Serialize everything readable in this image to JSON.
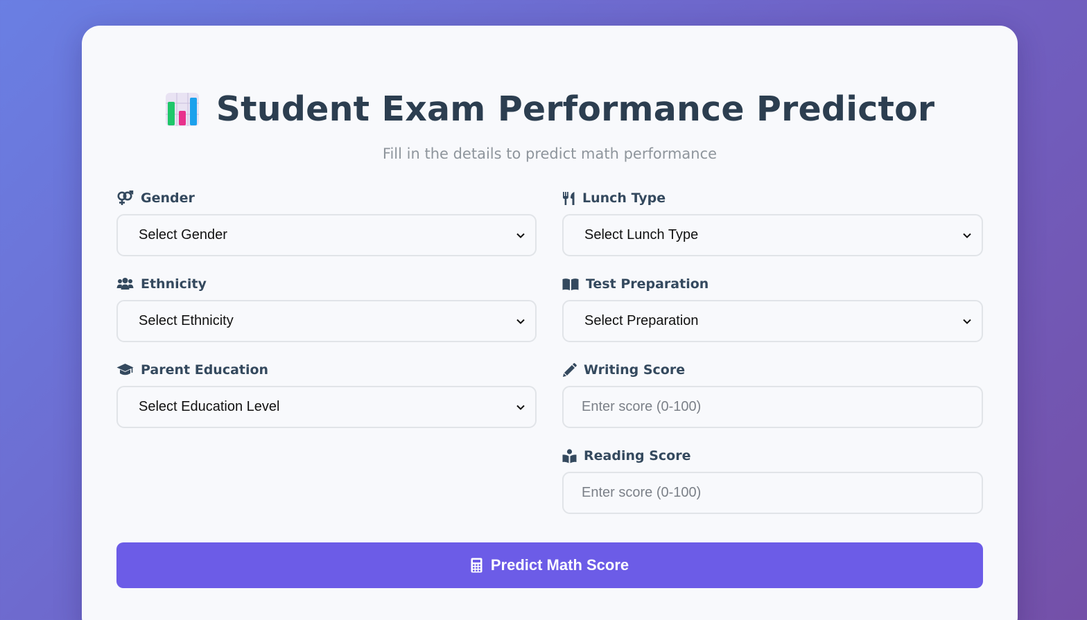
{
  "header": {
    "title": "Student Exam Performance Predictor",
    "subtitle": "Fill in the details to predict math performance",
    "icon": "bar-chart-icon"
  },
  "form": {
    "gender": {
      "label": "Gender",
      "icon": "venus-mars-icon",
      "value": "Select Gender"
    },
    "ethnicity": {
      "label": "Ethnicity",
      "icon": "users-icon",
      "value": "Select Ethnicity"
    },
    "parent_education": {
      "label": "Parent Education",
      "icon": "graduation-cap-icon",
      "value": "Select Education Level"
    },
    "lunch_type": {
      "label": "Lunch Type",
      "icon": "utensils-icon",
      "value": "Select Lunch Type"
    },
    "test_preparation": {
      "label": "Test Preparation",
      "icon": "book-open-icon",
      "value": "Select Preparation"
    },
    "writing_score": {
      "label": "Writing Score",
      "icon": "pencil-icon",
      "placeholder": "Enter score (0-100)"
    },
    "reading_score": {
      "label": "Reading Score",
      "icon": "book-reader-icon",
      "placeholder": "Enter score (0-100)"
    }
  },
  "submit": {
    "label": "Predict Math Score",
    "icon": "calculator-icon"
  },
  "colors": {
    "accent": "#6c5ce7",
    "title": "#2c3e50",
    "label": "#34495e",
    "subtitle": "#8e959c",
    "card": "#f8f9fc"
  }
}
